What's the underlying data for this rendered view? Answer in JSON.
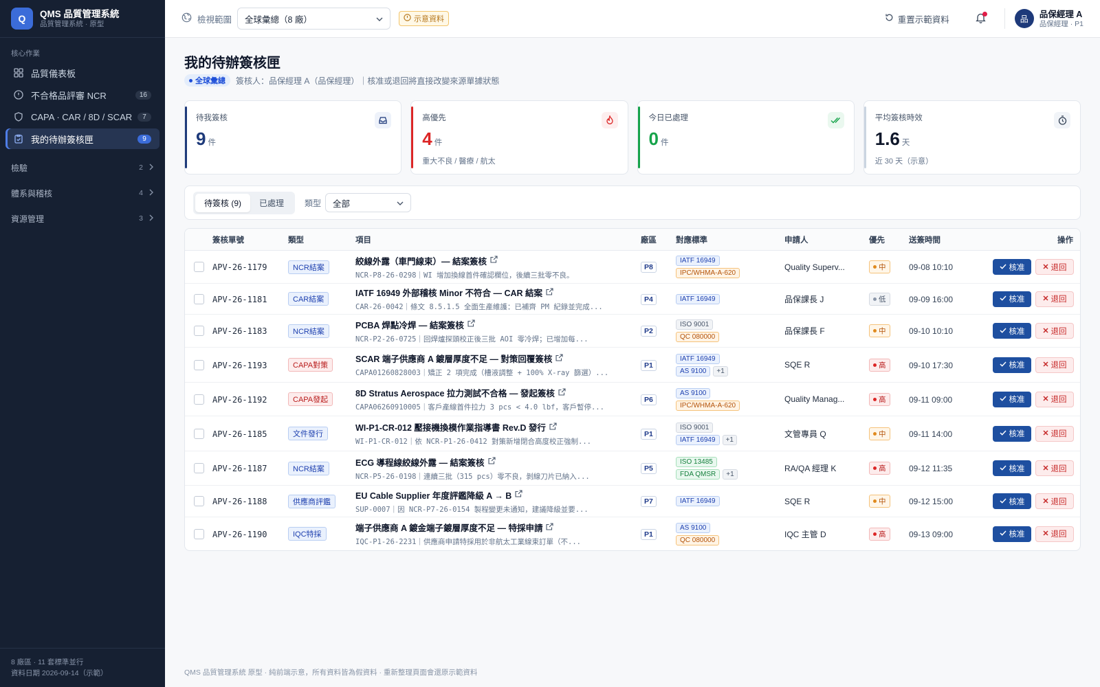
{
  "app": {
    "logo_letter": "Q",
    "title": "QMS 品質管理系統",
    "subtitle": "品質管理系統 · 原型"
  },
  "sidebar": {
    "section_label": "核心作業",
    "items": [
      {
        "label": "品質儀表板",
        "count": null,
        "icon": "dashboard-icon"
      },
      {
        "label": "不合格品評審 NCR",
        "count": "16",
        "icon": "alert-circle-icon"
      },
      {
        "label": "CAPA · CAR / 8D / SCAR",
        "count": "7",
        "icon": "shield-icon"
      },
      {
        "label": "我的待辦簽核匣",
        "count": "9",
        "icon": "clipboard-check-icon"
      }
    ],
    "groups": [
      {
        "label": "檢驗",
        "count": "2"
      },
      {
        "label": "體系與稽核",
        "count": "4"
      },
      {
        "label": "資源管理",
        "count": "3"
      }
    ],
    "footer_line1": "8 廠區 · 11 套標準並行",
    "footer_line2": "資料日期 2026-09-14（示範）"
  },
  "topbar": {
    "scope_label": "檢視範圍",
    "scope_value": "全球彙總（8 廠）",
    "demo_badge": "示意資料",
    "reset_label": "重置示範資料",
    "user_avatar": "品",
    "user_name": "品保經理 A",
    "user_role": "品保經理 · P1"
  },
  "page": {
    "title": "我的待辦簽核匣",
    "scope_chip": "全球彙總",
    "subtitle": "簽核人：品保經理 A（品保經理）｜核准或退回將直接改變來源單據狀態"
  },
  "cards": [
    {
      "label": "待我簽核",
      "value": "9",
      "unit": "件",
      "note": "",
      "color": "#1e3a7a"
    },
    {
      "label": "高優先",
      "value": "4",
      "unit": "件",
      "note": "重大不良 / 醫療 / 航太",
      "color": "#dc2626"
    },
    {
      "label": "今日已處理",
      "value": "0",
      "unit": "件",
      "note": "",
      "color": "#16a34a"
    },
    {
      "label": "平均簽核時效",
      "value": "1.6",
      "unit": "天",
      "note": "近 30 天（示意）",
      "color": "#0f172a"
    }
  ],
  "filter": {
    "tab_pending": "待簽核 (9)",
    "tab_done": "已處理",
    "type_label": "類型",
    "type_value": "全部"
  },
  "table": {
    "headers": [
      "簽核單號",
      "類型",
      "項目",
      "廠區",
      "對應標準",
      "申請人",
      "優先",
      "送簽時間",
      "操作"
    ],
    "approve_label": "核准",
    "reject_label": "退回",
    "rows": [
      {
        "id": "APV-26-1179",
        "type": "NCR結案",
        "tcolor": "ncr",
        "title": "絞線外露（車門線束）— 結案簽核",
        "sub": "NCR-P8-26-0298｜WI 增加換線首件確認欄位，後續三批零不良。",
        "fac": "P8",
        "stds": [
          [
            "IATF 16949",
            "blue"
          ],
          [
            "IPC/WHMA-A-620",
            "orange"
          ]
        ],
        "more": "",
        "applicant": "Quality Superv...",
        "pri": "中",
        "pcls": "mid",
        "time": "09-08 10:10",
        "h": 48
      },
      {
        "id": "APV-26-1181",
        "type": "CAR結案",
        "tcolor": "ncr",
        "title": "IATF 16949 外部稽核 Minor 不符合 — CAR 結案",
        "sub": "CAR-26-0042｜條文 8.5.1.5 全面生產維護：已補齊 PM 紀錄並完成...",
        "fac": "P4",
        "stds": [
          [
            "IATF 16949",
            "blue"
          ]
        ],
        "more": "",
        "applicant": "品保課長 J",
        "pri": "低",
        "pcls": "low",
        "time": "09-09 16:00",
        "h": 45
      },
      {
        "id": "APV-26-1183",
        "type": "NCR結案",
        "tcolor": "ncr",
        "title": "PCBA 焊點冷焊 — 結案簽核",
        "sub": "NCR-P2-26-0725｜回焊爐探頭校正後三批 AOI 零冷焊；已增加每...",
        "fac": "P2",
        "stds": [
          [
            "ISO 9001",
            "gray"
          ],
          [
            "QC 080000",
            "orange"
          ]
        ],
        "more": "",
        "applicant": "品保課長 F",
        "pri": "中",
        "pcls": "mid",
        "time": "09-10 10:10",
        "h": 48
      },
      {
        "id": "APV-26-1193",
        "type": "CAPA對策",
        "tcolor": "capa",
        "title": "SCAR 端子供應商 A 鍍層厚度不足 — 對策回覆簽核",
        "sub": "CAPA01260828003｜矯正 2 項完成（槽液調整 + 100% X-ray 篩選）...",
        "fac": "P1",
        "stds": [
          [
            "IATF 16949",
            "blue"
          ],
          [
            "AS 9100",
            "blue"
          ]
        ],
        "more": "+1",
        "applicant": "SQE R",
        "pri": "高",
        "pcls": "high",
        "time": "09-10 17:30",
        "h": 51
      },
      {
        "id": "APV-26-1192",
        "type": "CAPA發起",
        "tcolor": "capa",
        "title": "8D Stratus Aerospace 拉力測試不合格 — 發起簽核",
        "sub": "CAPA06260910005｜客戶產線首件拉力 3 pcs < 4.0 lbf，客戶暫停...",
        "fac": "P6",
        "stds": [
          [
            "AS 9100",
            "blue"
          ],
          [
            "IPC/WHMA-A-620",
            "orange"
          ]
        ],
        "more": "",
        "applicant": "Quality Manag...",
        "pri": "高",
        "pcls": "high",
        "time": "09-11 09:00",
        "h": 49
      },
      {
        "id": "APV-26-1185",
        "type": "文件發行",
        "tcolor": "ncr",
        "title": "WI-P1-CR-012 壓接機換模作業指導書 Rev.D 發行",
        "sub": "WI-P1-CR-012｜依 NCR-P1-26-0412 對策新增閉合高度校正強制...",
        "fac": "P1",
        "stds": [
          [
            "ISO 9001",
            "gray"
          ],
          [
            "IATF 16949",
            "blue"
          ]
        ],
        "more": "+1",
        "applicant": "文管專員 Q",
        "pri": "中",
        "pcls": "mid",
        "time": "09-11 14:00",
        "h": 51
      },
      {
        "id": "APV-26-1187",
        "type": "NCR結案",
        "tcolor": "ncr",
        "title": "ECG 導程線絞線外露 — 結案簽核",
        "sub": "NCR-P5-26-0198｜連續三批（315 pcs）零不良，剝線刀片已納入...",
        "fac": "P5",
        "stds": [
          [
            "ISO 13485",
            "green"
          ],
          [
            "FDA QMSR",
            "green"
          ]
        ],
        "more": "+1",
        "applicant": "RA/QA 經理 K",
        "pri": "高",
        "pcls": "high",
        "time": "09-12 11:35",
        "h": 50
      },
      {
        "id": "APV-26-1188",
        "type": "供應商評鑑",
        "tcolor": "ncr",
        "title": "EU Cable Supplier 年度評鑑降級 A → B",
        "sub": "SUP-0007｜因 NCR-P7-26-0154 製程變更未通知，建議降級並要...",
        "fac": "P7",
        "stds": [
          [
            "IATF 16949",
            "blue"
          ]
        ],
        "more": "",
        "applicant": "SQE R",
        "pri": "中",
        "pcls": "mid",
        "time": "09-12 15:00",
        "h": 46
      },
      {
        "id": "APV-26-1190",
        "type": "IQC特採",
        "tcolor": "ncr",
        "title": "端子供應商 A 鍍金端子鍍層厚度不足 — 特採申請",
        "sub": "IQC-P1-26-2231｜供應商申請特採用於非航太工業線束訂單（不...",
        "fac": "P1",
        "stds": [
          [
            "AS 9100",
            "blue"
          ],
          [
            "QC 080000",
            "orange"
          ]
        ],
        "more": "",
        "applicant": "IQC 主管 D",
        "pri": "高",
        "pcls": "high",
        "time": "09-13 09:00",
        "h": 48
      }
    ]
  },
  "footer": "QMS 品質管理系統 原型 · 純前端示意，所有資料皆為假資料 · 重新整理頁面會還原示範資料"
}
